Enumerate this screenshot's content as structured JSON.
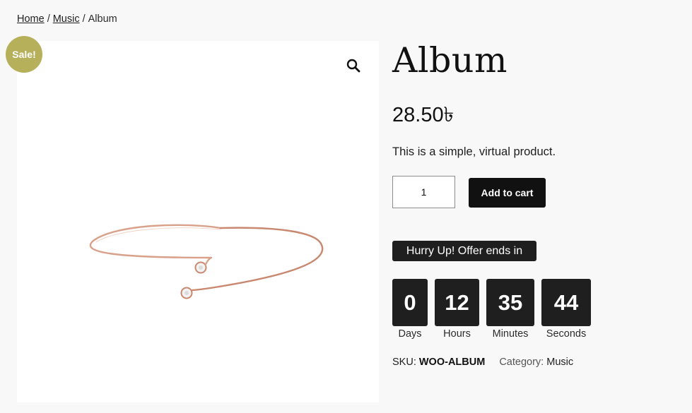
{
  "breadcrumb": {
    "items": [
      "Home",
      "Music"
    ],
    "current": "Album",
    "separator": "/"
  },
  "gallery": {
    "sale_badge": "Sale!",
    "zoom_icon": "magnifier-icon",
    "image": "rose-gold-bracelet"
  },
  "product": {
    "title": "Album",
    "price": "28.50৳",
    "short_description": "This is a simple, virtual product.",
    "quantity": "1",
    "add_to_cart_label": "Add to cart"
  },
  "countdown": {
    "heading": "Hurry Up! Offer ends in",
    "units": [
      {
        "value": "0",
        "label": "Days"
      },
      {
        "value": "12",
        "label": "Hours"
      },
      {
        "value": "35",
        "label": "Minutes"
      },
      {
        "value": "44",
        "label": "Seconds"
      }
    ]
  },
  "meta": {
    "sku_label": "SKU:",
    "sku_value": "WOO-ALBUM",
    "category_label": "Category:",
    "category_value": "Music"
  },
  "colors": {
    "page_background": "#f8f8f8",
    "sale_badge": "#b6b05a",
    "button_dark": "#111111",
    "countdown_box": "#1f1f1f",
    "bracelet": "#d4937f"
  }
}
